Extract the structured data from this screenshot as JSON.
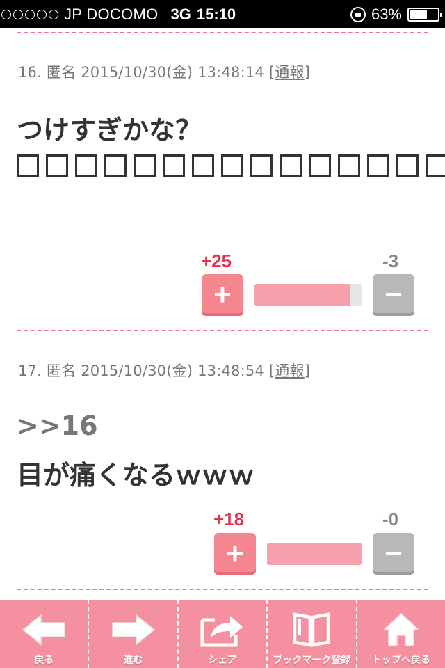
{
  "status_bar": {
    "carrier": "JP DOCOMO",
    "network": "3G",
    "time": "15:10",
    "battery": "63%",
    "battery_level": 0.63
  },
  "comments": [
    {
      "number": "16.",
      "name": "匿名",
      "datetime": "2015/10/30(金) 13:48:14",
      "report_open": "[",
      "report_label": "通報",
      "report_close": "]",
      "text_line1": "つけすぎかな？",
      "plus_count": "+25",
      "minus_count": "-3",
      "plus_label": "+",
      "minus_label": "−",
      "vote_ratio": 0.89
    },
    {
      "number": "17.",
      "name": "匿名",
      "datetime": "2015/10/30(金) 13:48:54",
      "report_open": "[",
      "report_label": "通報",
      "report_close": "]",
      "anchor": ">>16",
      "text_line1": "目が痛くなるｗｗｗ",
      "plus_count": "+18",
      "minus_count": "-0",
      "plus_label": "+",
      "minus_label": "−",
      "vote_ratio": 1.0
    }
  ],
  "toolbar": {
    "back": "戻る",
    "forward": "進む",
    "share": "シェア",
    "bookmark": "ブックマーク登録",
    "top": "トップへ戻る"
  },
  "colors": {
    "accent": "#f4909f",
    "plus": "#e2334f",
    "dash": "#e8788f"
  }
}
